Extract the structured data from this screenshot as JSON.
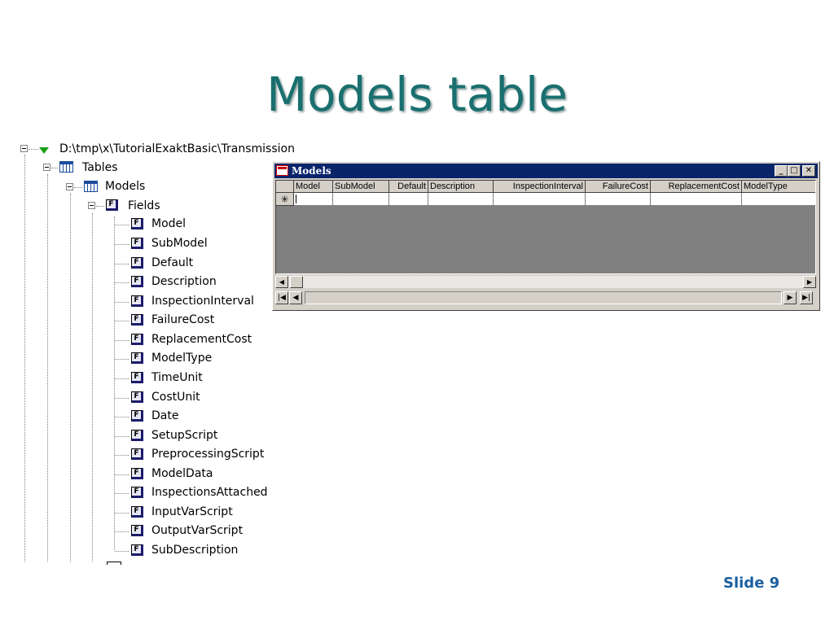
{
  "slide": {
    "title": "Models table",
    "number_label": "Slide 9"
  },
  "tree": {
    "root_label": "D:\\tmp\\x\\TutorialExaktBasic\\Transmission",
    "tables_label": "Tables",
    "models_label": "Models",
    "fields_label": "Fields",
    "field_icon_letter": "F",
    "fields": [
      "Model",
      "SubModel",
      "Default",
      "Description",
      "InspectionInterval",
      "FailureCost",
      "ReplacementCost",
      "ModelType",
      "TimeUnit",
      "CostUnit",
      "Date",
      "SetupScript",
      "PreprocessingScript",
      "ModelData",
      "InspectionsAttached",
      "InputVarScript",
      "OutputVarScript",
      "SubDescription"
    ]
  },
  "window": {
    "title": "Models",
    "minimize_glyph": "_",
    "maximize_glyph": "□",
    "close_glyph": "✕",
    "columns": [
      "Model",
      "SubModel",
      "Default",
      "Description",
      "InspectionInterval",
      "FailureCost",
      "ReplacementCost",
      "ModelType"
    ],
    "new_row_marker": "✳",
    "scroll_left_glyph": "◀",
    "scroll_right_glyph": "▶",
    "nav_first_glyph": "|◀",
    "nav_prev_glyph": "◀",
    "nav_next_glyph": "▶",
    "nav_last_glyph": "▶|",
    "colors": {
      "titlebar": "#0a246a",
      "face": "#d4d0c8"
    }
  },
  "icons": {
    "root": "database-icon",
    "table": "table-icon",
    "field": "field-icon",
    "expander": "collapse-icon"
  }
}
